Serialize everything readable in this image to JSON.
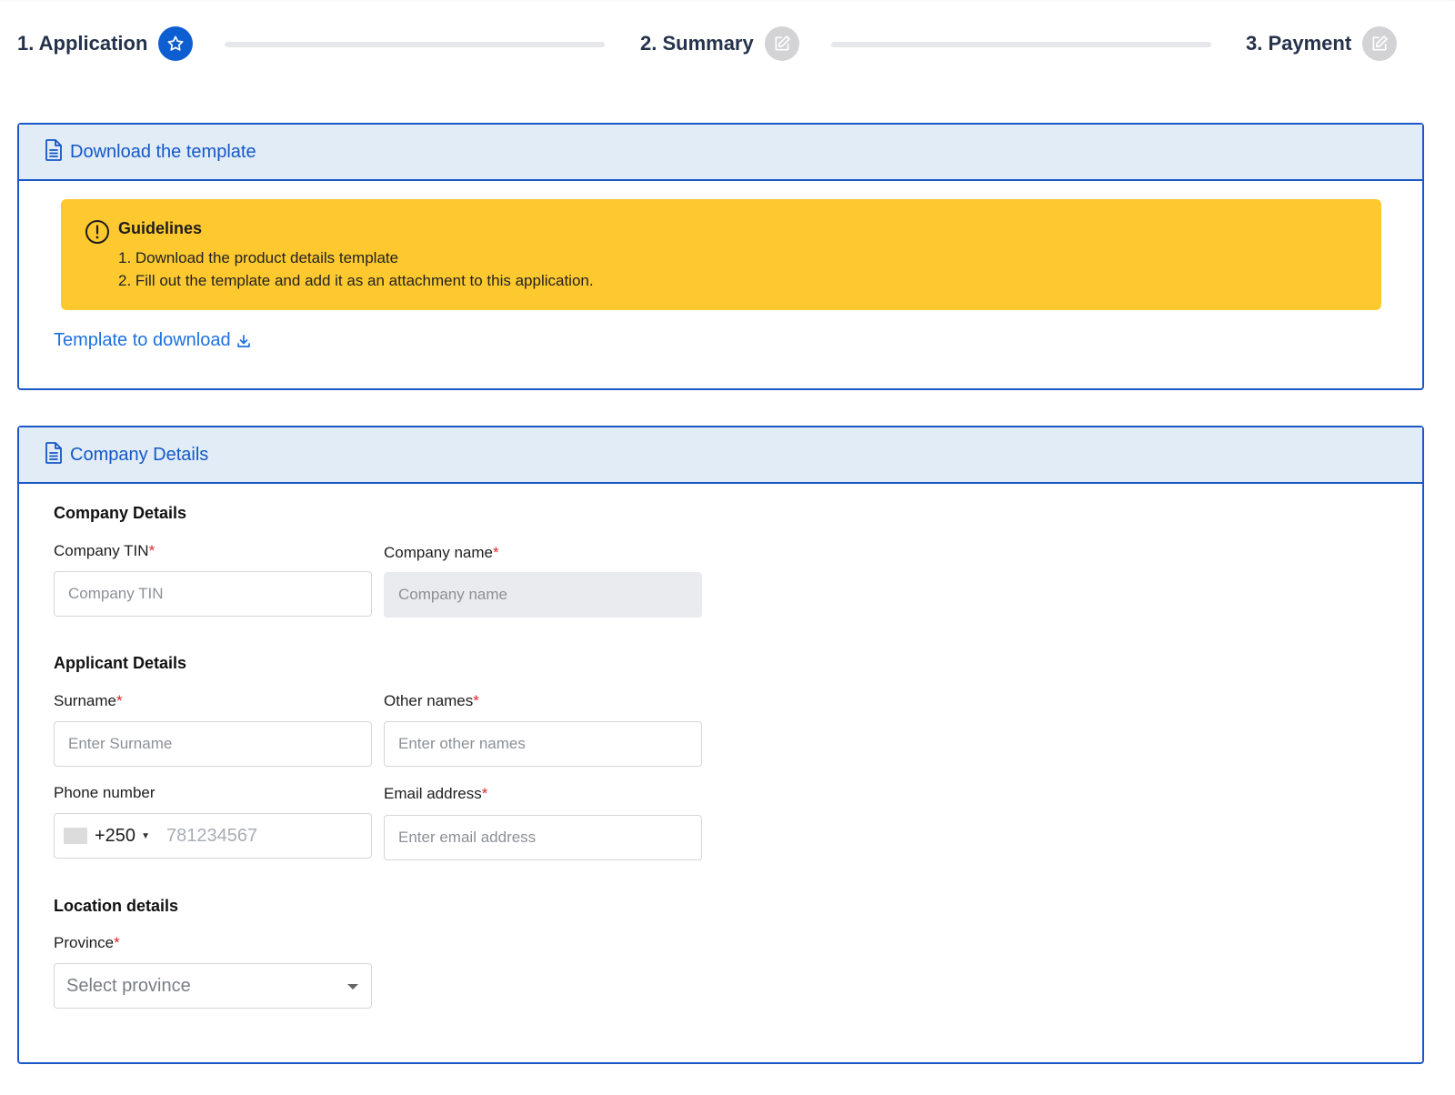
{
  "stepper": {
    "steps": [
      {
        "label": "1. Application",
        "state": "active"
      },
      {
        "label": "2. Summary",
        "state": "inactive"
      },
      {
        "label": "3. Payment",
        "state": "inactive"
      }
    ]
  },
  "download_card": {
    "title": "Download the template",
    "guidelines": {
      "title": "Guidelines",
      "items": [
        "1. Download the product details template",
        "2. Fill out the template and add it as an attachment to this application."
      ]
    },
    "link_label": "Template to download"
  },
  "company_card": {
    "title": "Company Details",
    "company_section": {
      "title": "Company Details",
      "tin_label": "Company TIN",
      "tin_placeholder": "Company TIN",
      "name_label": "Company name",
      "name_placeholder": "Company name"
    },
    "applicant_section": {
      "title": "Applicant Details",
      "surname_label": "Surname",
      "surname_placeholder": "Enter Surname",
      "other_names_label": "Other names",
      "other_names_placeholder": "Enter other names",
      "phone_label": "Phone number",
      "phone_code": "+250",
      "phone_placeholder": "781234567",
      "email_label": "Email address",
      "email_placeholder": "Enter email address"
    },
    "location_section": {
      "title": "Location details",
      "province_label": "Province",
      "province_placeholder": "Select province"
    },
    "required_marker": "*"
  },
  "colors": {
    "primary": "#0d5fd1",
    "card_border": "#1a58c8",
    "card_header_bg": "#e1ecf7",
    "warning_bg": "#fec92f",
    "link": "#1d72e0",
    "required": "#e0242b"
  }
}
